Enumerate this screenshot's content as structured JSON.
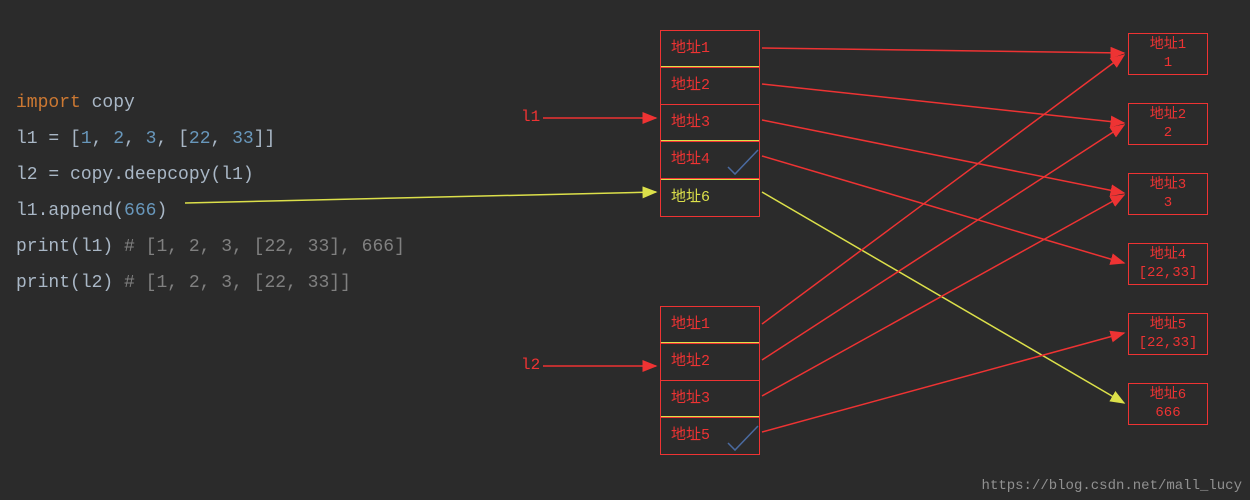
{
  "code": {
    "line1_import": "import",
    "line1_mod": "copy",
    "line2_lhs": "l1",
    "line2_eq": " = ",
    "line2_open": "[",
    "line2_n1": "1",
    "line2_c1": ", ",
    "line2_n2": "2",
    "line2_c2": ", ",
    "line2_n3": "3",
    "line2_c3": ", ",
    "line2_in_open": "[",
    "line2_in1": "22",
    "line2_cin": ", ",
    "line2_in2": "33",
    "line2_in_close": "]",
    "line2_close": "]",
    "line3_lhs": "l2",
    "line3_eq": " = ",
    "line3_mod": "copy",
    "line3_dot": ".",
    "line3_fn": "deepcopy",
    "line3_arg": "(l1)",
    "line4_lhs": "l1",
    "line4_dot": ".",
    "line4_fn": "append",
    "line4_open": "(",
    "line4_arg": "666",
    "line4_close": ")",
    "line5_fn": "print",
    "line5_arg": "(l1)",
    "line5_comment": "  # [1, 2, 3, [22, 33], 666]",
    "line6_fn": "print",
    "line6_arg": "(l2)",
    "line6_comment": "  # [1, 2, 3, [22, 33]]"
  },
  "labels": {
    "l1": "l1",
    "l2": "l2"
  },
  "l1_box": {
    "c1": "地址1",
    "c2": "地址2",
    "c3": "地址3",
    "c4": "地址4",
    "c5": "地址6"
  },
  "l2_box": {
    "c1": "地址1",
    "c2": "地址2",
    "c3": "地址3",
    "c4": "地址5"
  },
  "values": {
    "v1_lbl": "地址1",
    "v1_val": "1",
    "v2_lbl": "地址2",
    "v2_val": "2",
    "v3_lbl": "地址3",
    "v3_val": "3",
    "v4_lbl": "地址4",
    "v4_val": "[22,33]",
    "v5_lbl": "地址5",
    "v5_val": "[22,33]",
    "v6_lbl": "地址6",
    "v6_val": "666"
  },
  "watermark": "https://blog.csdn.net/mall_lucy"
}
